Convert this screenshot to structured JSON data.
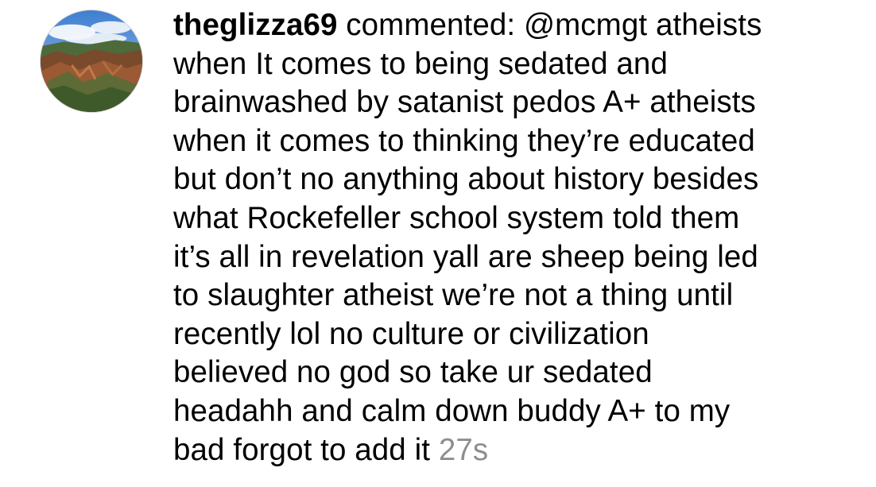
{
  "notification": {
    "username": "theglizza69",
    "action": "commented:",
    "mention": "@mcmgt",
    "lines": [
      "atheists",
      "when It comes to being sedated and",
      "brainwashed by satanist pedos A+ atheists",
      "when it comes to thinking they’re educated",
      "but don’t no anything about history besides",
      "what Rockefeller school system told them",
      "it’s all in revelation yall are sheep being led",
      "to slaughter atheist we’re not a thing until",
      "recently lol no culture or civilization",
      "believed no god so take ur sedated",
      "headahh and calm down buddy A+ to my",
      "bad forgot to add it"
    ],
    "timestamp": "27s"
  },
  "avatar": {
    "icon": "canyon-landscape-photo"
  },
  "colors": {
    "text": "#000000",
    "timestamp": "#8e8e8e",
    "background": "#ffffff"
  }
}
